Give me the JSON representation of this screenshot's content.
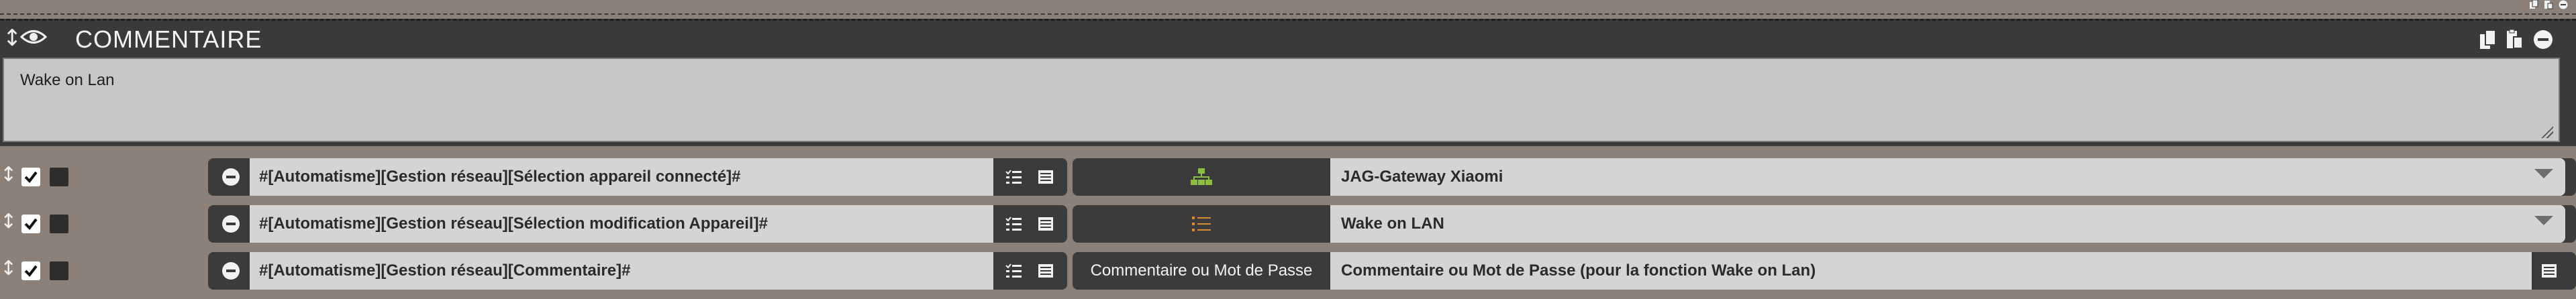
{
  "header": {
    "title": "COMMENTAIRE",
    "move_icon": "move-vertical-icon",
    "visibility_icon": "eye-icon",
    "actions": [
      "copy-icon",
      "paste-icon",
      "remove-icon"
    ]
  },
  "comment": {
    "text": "Wake on Lan"
  },
  "rows": [
    {
      "command": "#[Automatisme][Gestion réseau][Sélection appareil connecté]#",
      "value_icon": "network-icon",
      "value_icon_color": "#8cbf3f",
      "value": "JAG-Gateway Xiaomi",
      "value_type": "select"
    },
    {
      "command": "#[Automatisme][Gestion réseau][Sélection modification Appareil]#",
      "value_icon": "list-icon",
      "value_icon_color": "#d68b2e",
      "value": "Wake on LAN",
      "value_type": "select"
    },
    {
      "command": "#[Automatisme][Gestion réseau][Commentaire]#",
      "value_label": "Commentaire ou Mot de Passe",
      "value": "Commentaire ou Mot de Passe (pour la fonction Wake on Lan)",
      "value_type": "text"
    }
  ],
  "colors": {
    "background": "#8c8179",
    "panel": "#3a3a3a",
    "input": "#d4d4d4",
    "checkbox": "#ffffff"
  }
}
